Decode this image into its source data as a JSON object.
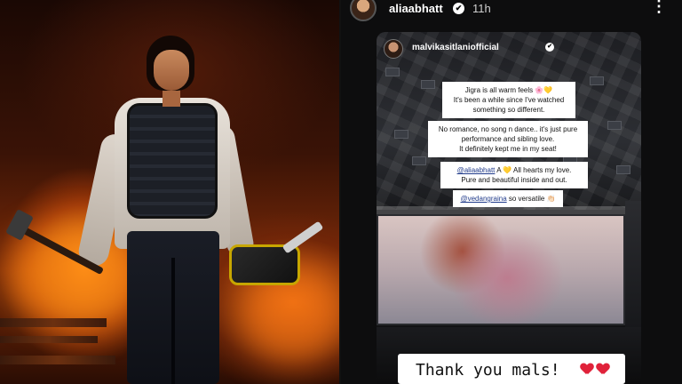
{
  "story": {
    "username": "aliaabhatt",
    "verified_mark": "✔",
    "time": "11h",
    "more_label": "⋮"
  },
  "repost": {
    "username": "malvikasitlaniofficial",
    "verified_mark": "✔",
    "stickers": [
      {
        "lines": [
          "Jigra is all warm feels 🌸💛",
          "It's been a while since I've watched",
          "something so different."
        ]
      },
      {
        "lines": [
          "No romance, no song n dance.. it's just pure",
          "performance and sibling love.",
          "It definitely kept me in my seat!"
        ]
      },
      {
        "mention": "@aliaabhatt",
        "text_after": " A 💛 All hearts my love.",
        "line2": "Pure and beautiful inside and out."
      },
      {
        "mention": "@vedangraina",
        "text_after": " so versatile 👏🏻"
      }
    ]
  },
  "caption": {
    "text": "Thank you mals!",
    "hearts": [
      "heart-icon",
      "heart-icon"
    ],
    "heart_color": "#e0223a"
  },
  "icons": {
    "verified": "verified-badge-icon",
    "more": "more-options-icon"
  }
}
